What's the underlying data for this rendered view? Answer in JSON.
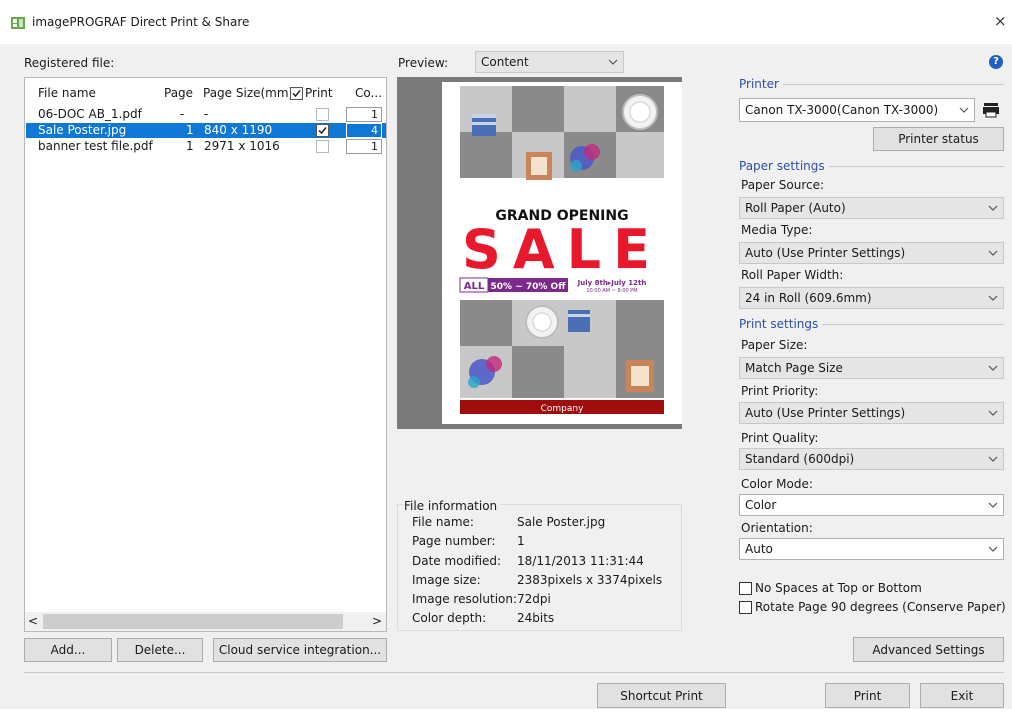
{
  "window": {
    "title": "imagePROGRAF Direct Print & Share",
    "close_glyph": "×"
  },
  "registered_label": "Registered file:",
  "file_list": {
    "headers": {
      "name": "File name",
      "page": "Page",
      "size": "Page Size(mm)",
      "print": "Print",
      "copies": "Co..."
    },
    "rows": [
      {
        "name": "06-DOC AB_1.pdf",
        "page": "-",
        "size": "-",
        "print": false,
        "copies": "1",
        "selected": false
      },
      {
        "name": "Sale Poster.jpg",
        "page": "1",
        "size": "840 x 1190",
        "print": true,
        "copies": "4",
        "selected": true
      },
      {
        "name": "banner test file.pdf",
        "page": "1",
        "size": "2971 x 1016",
        "print": false,
        "copies": "1",
        "selected": false
      }
    ],
    "scroll_left": "<",
    "scroll_right": ">"
  },
  "buttons": {
    "add": "Add...",
    "delete": "Delete...",
    "cloud": "Cloud service integration...",
    "printer_status": "Printer status",
    "advanced": "Advanced Settings",
    "shortcut_print": "Shortcut Print",
    "print": "Print",
    "exit": "Exit"
  },
  "preview": {
    "label": "Preview:",
    "mode": "Content",
    "poster": {
      "headline": "GRAND OPENING",
      "sale": "SALE",
      "all": "ALL",
      "discount": "50% ~ 70% Off",
      "dates": "July 8th▸July 12th",
      "hours": "10:00 AM ~ 8:00 PM",
      "footer": "Company"
    }
  },
  "file_info": {
    "title": "File information",
    "rows": [
      {
        "label": "File name:",
        "value": "Sale Poster.jpg"
      },
      {
        "label": "Page number:",
        "value": "1"
      },
      {
        "label": "Date modified:",
        "value": "18/11/2013 11:31:44"
      },
      {
        "label": "Image size:",
        "value": "2383pixels x 3374pixels"
      },
      {
        "label": "Image resolution:",
        "value": "72dpi"
      },
      {
        "label": "Color depth:",
        "value": "24bits"
      }
    ]
  },
  "printer": {
    "group": "Printer",
    "selected": "Canon TX-3000(Canon TX-3000)"
  },
  "paper_settings": {
    "group": "Paper settings",
    "source_label": "Paper Source:",
    "source": "Roll Paper (Auto)",
    "media_label": "Media Type:",
    "media": "Auto (Use Printer Settings)",
    "width_label": "Roll Paper Width:",
    "width": "24 in Roll (609.6mm)"
  },
  "print_settings": {
    "group": "Print settings",
    "size_label": "Paper Size:",
    "size": "Match Page Size",
    "priority_label": "Print Priority:",
    "priority": "Auto (Use Printer Settings)",
    "quality_label": "Print Quality:",
    "quality": "Standard (600dpi)",
    "color_label": "Color Mode:",
    "color": "Color",
    "orientation_label": "Orientation:",
    "orientation": "Auto"
  },
  "options": {
    "no_spaces": "No Spaces at Top or Bottom",
    "rotate": "Rotate Page 90 degrees (Conserve Paper)"
  },
  "help_glyph": "?",
  "colors": {
    "selection": "#0f78d7",
    "group_title": "#2b4fa8",
    "sale_red": "#e8192c",
    "purple": "#7b2a8c",
    "footer_red": "#a00d0d"
  }
}
